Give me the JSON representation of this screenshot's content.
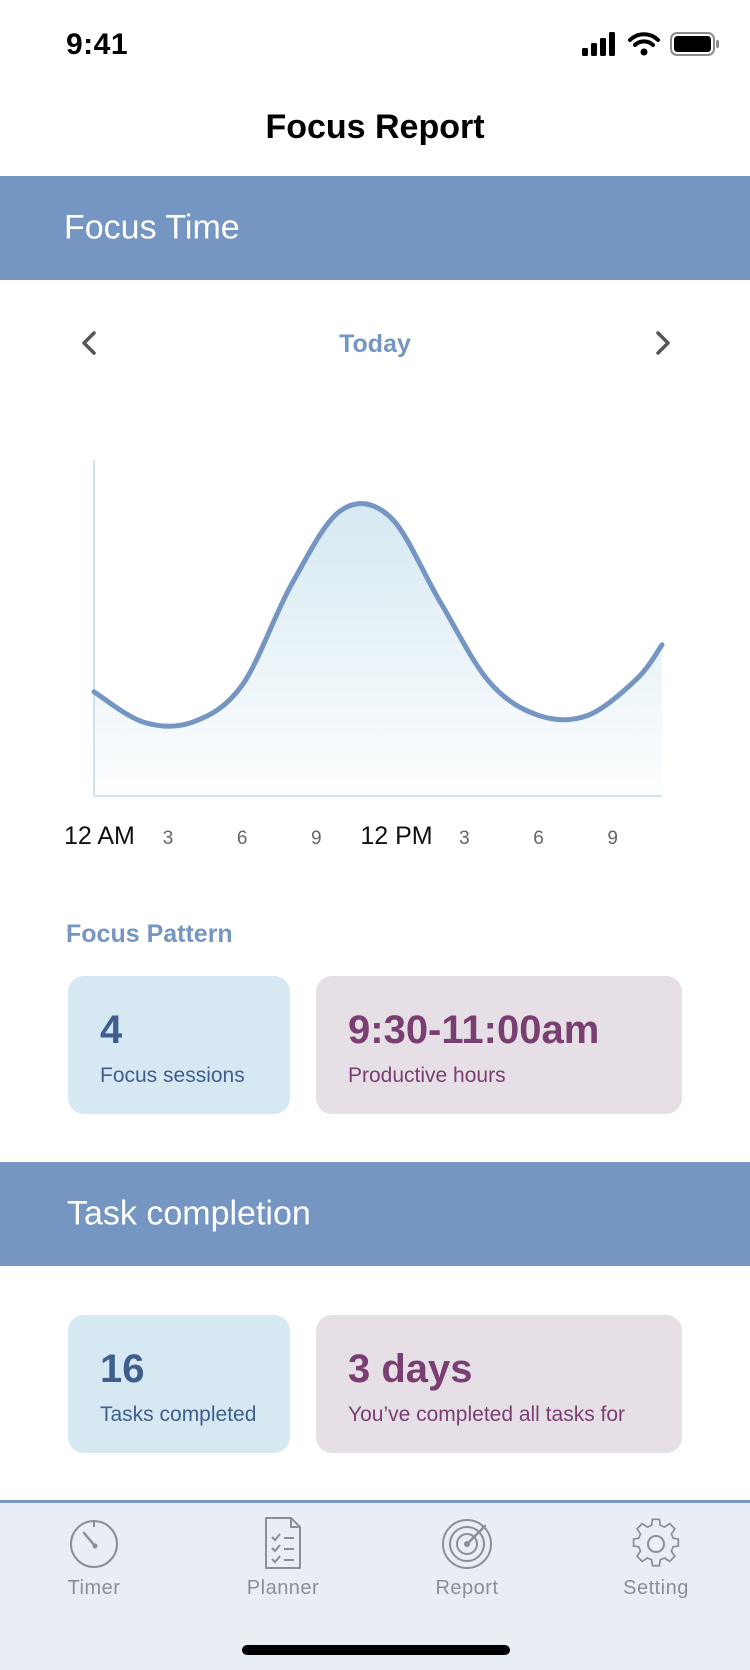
{
  "status_bar": {
    "time": "9:41",
    "icons": [
      "signal-icon",
      "wifi-icon",
      "battery-icon"
    ]
  },
  "page": {
    "title": "Focus Report"
  },
  "focus_section": {
    "title": "Focus Time"
  },
  "date_nav": {
    "period": "Today",
    "prev_icon": "chevron-left-icon",
    "next_icon": "chevron-right-icon"
  },
  "chart_data": {
    "type": "area",
    "title": "",
    "xlabel": "",
    "ylabel": "",
    "x_ticks": [
      "12 AM",
      "3",
      "6",
      "9",
      "12 PM",
      "3",
      "6",
      "9"
    ],
    "x": [
      0,
      2,
      4,
      6,
      8,
      10,
      12,
      14,
      16,
      18,
      20,
      22,
      23
    ],
    "y": [
      0.31,
      0.22,
      0.22,
      0.33,
      0.63,
      0.85,
      0.83,
      0.58,
      0.34,
      0.24,
      0.24,
      0.35,
      0.45
    ],
    "xlim": [
      0,
      23
    ],
    "ylim": [
      0,
      1
    ],
    "grid": false,
    "legend": "none",
    "line_color": "#7595c2",
    "fill_color": "#d6e9f2"
  },
  "focus_pattern": {
    "label": "Focus Pattern",
    "sessions_value": "4",
    "sessions_caption": "Focus sessions",
    "hours_value": "9:30-11:00am",
    "hours_caption": "Productive hours"
  },
  "task_section": {
    "title": "Task completion",
    "tasks_value": "16",
    "tasks_caption": "Tasks completed",
    "days_value": "3 days",
    "days_caption": "You’ve completed all tasks for"
  },
  "tabbar": {
    "items": [
      {
        "label": "Timer",
        "icon": "timer-icon"
      },
      {
        "label": "Planner",
        "icon": "planner-icon"
      },
      {
        "label": "Report",
        "icon": "report-icon"
      },
      {
        "label": "Setting",
        "icon": "gear-icon"
      }
    ]
  },
  "colors": {
    "accent": "#7595c2",
    "card_blue": "#d6e9f2",
    "card_blue_text": "#3f5e8e",
    "card_purple": "#e7dfe6",
    "card_purple_text": "#7a3f72"
  }
}
